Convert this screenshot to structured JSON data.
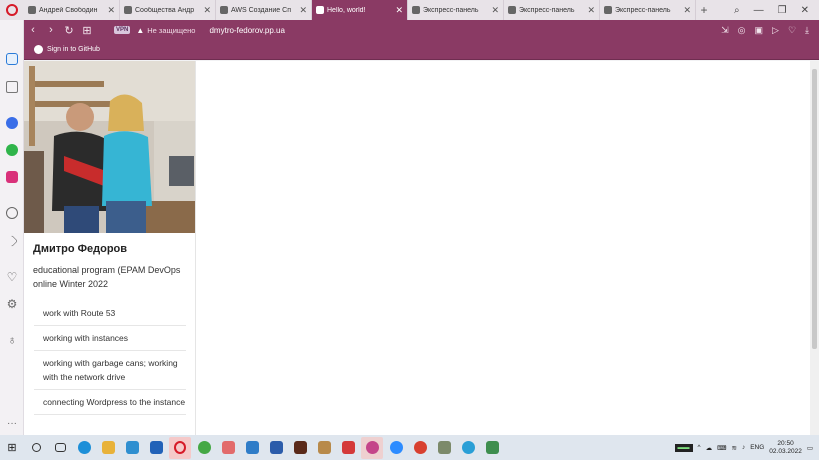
{
  "browser": {
    "tabs": [
      {
        "title": "Андрей Свободин"
      },
      {
        "title": "Сообщества Андр"
      },
      {
        "title": "AWS Создание Сп"
      },
      {
        "title": "Hello, world!"
      },
      {
        "title": "Экспресс-панель"
      },
      {
        "title": "Экспресс-панель"
      },
      {
        "title": "Экспресс-панель"
      }
    ],
    "active_tab_index": 3,
    "vpn_label": "VPN",
    "security_label": "Не защищено",
    "url": "dmytro-fedorov.pp.ua",
    "bookmark": "Sign in to GitHub",
    "accent_color": "#8a3a64"
  },
  "page": {
    "author_name": "Дмитро Федоров",
    "description": "educational program (EPAM DevOps online Winter 2022",
    "menu": [
      "work with Route 53",
      "working with instances",
      "working with garbage cans; working with the network drive",
      "connecting Wordpress to the instance"
    ]
  },
  "taskbar": {
    "lang": "ENG",
    "time": "20:50",
    "date": "02.03.2022"
  }
}
